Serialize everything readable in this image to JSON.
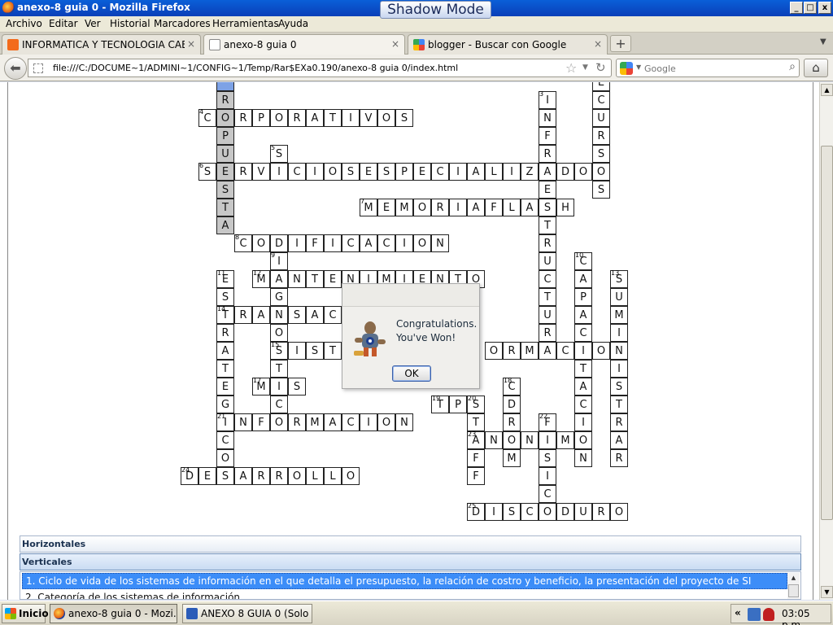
{
  "window": {
    "title": "anexo-8 guia 0 - Mozilla Firefox",
    "shadow_mode": "Shadow Mode",
    "min": "_",
    "max": "□",
    "close": "x"
  },
  "menu": [
    "Archivo",
    "Editar",
    "Ver",
    "Historial",
    "Marcadores",
    "Herramientas",
    "Ayuda"
  ],
  "tabs": [
    {
      "label": "INFORMATICA Y TECNOLOGIA CAE: 10º ...",
      "icon_color": "#f36b1c"
    },
    {
      "label": "anexo-8 guia 0",
      "icon_color": "#ffffff"
    },
    {
      "label": "blogger - Buscar con Google",
      "icon_color": "#4285f4"
    }
  ],
  "tab_close": "×",
  "new_tab": "+",
  "nav": {
    "url": "file:///C:/DOCUME~1/ADMINI~1/CONFIG~1/Temp/Rar$EXa0.190/anexo-8 guia 0/index.html",
    "search_placeholder": "Google"
  },
  "dialog": {
    "line1": "Congratulations.",
    "line2": "You've Won!",
    "ok": "OK"
  },
  "clues": {
    "horizontales": "Horizontales",
    "verticales": "Verticales",
    "items": [
      "1. Ciclo de vida de los sistemas de información en el que detalla el presupuesto, la relación de costro y beneficio, la presentación del proyecto de SI",
      "2. Categoría de los sistemas de información"
    ]
  },
  "taskbar": {
    "start": "Inicio",
    "items": [
      "anexo-8 guia 0 - Mozi...",
      "ANEXO 8 GUIA 0 (Solo le..."
    ],
    "chevron": "«",
    "clock": "03:05 p.m."
  },
  "crossword": {
    "highlight_color": "#c7c7c7",
    "selected_color": "#7da2e6",
    "words": [
      {
        "num": "",
        "text": "ROPUESTA",
        "col": 12,
        "row": 1,
        "dir": "down",
        "hl": true
      },
      {
        "num": "2",
        "text": "ECURSOS",
        "col": 33,
        "row": 0,
        "dir": "down"
      },
      {
        "num": "3",
        "text": "INFRAESTRUCTURA",
        "col": 30,
        "row": 1,
        "dir": "down"
      },
      {
        "num": "4",
        "text": "CORPORATIVOS",
        "col": 11,
        "row": 2,
        "dir": "across"
      },
      {
        "num": "5",
        "text": "S",
        "col": 15,
        "row": 4,
        "dir": "across"
      },
      {
        "num": "6",
        "text": "SERVICIOSESPECIALIZADOS",
        "col": 11,
        "row": 5,
        "dir": "across"
      },
      {
        "num": "7",
        "text": "MEMORIAFLASH",
        "col": 20,
        "row": 7,
        "dir": "across"
      },
      {
        "num": "8",
        "text": "CODIFICACION",
        "col": 13,
        "row": 9,
        "dir": "across"
      },
      {
        "num": "9",
        "text": "IAGNOSTIC",
        "col": 15,
        "row": 10,
        "dir": "down"
      },
      {
        "num": "10",
        "text": "CAPACITACION",
        "col": 32,
        "row": 10,
        "dir": "down"
      },
      {
        "num": "11",
        "text": "ESTRATEGICO",
        "col": 12,
        "row": 11,
        "dir": "down"
      },
      {
        "num": "12",
        "text": "MANTENIMIENTO",
        "col": 14,
        "row": 11,
        "dir": "across"
      },
      {
        "num": "13",
        "text": "SUMINISTRAR",
        "col": 34,
        "row": 11,
        "dir": "down"
      },
      {
        "num": "14",
        "text": "TRANSAC",
        "col": 12,
        "row": 13,
        "dir": "across"
      },
      {
        "num": "15",
        "text": "SIST",
        "col": 15,
        "row": 15,
        "dir": "across"
      },
      {
        "num": "",
        "text": "ORMACION",
        "col": 27,
        "row": 15,
        "dir": "across"
      },
      {
        "num": "17",
        "text": "MIS",
        "col": 14,
        "row": 17,
        "dir": "across"
      },
      {
        "num": "18",
        "text": "CDROM",
        "col": 28,
        "row": 17,
        "dir": "down"
      },
      {
        "num": "19",
        "text": "TPS",
        "col": 24,
        "row": 18,
        "dir": "across"
      },
      {
        "num": "20",
        "text": "STAFF",
        "col": 26,
        "row": 18,
        "dir": "down"
      },
      {
        "num": "21",
        "text": "INFORMACION",
        "col": 12,
        "row": 19,
        "dir": "across"
      },
      {
        "num": "22",
        "text": "FISIC",
        "col": 30,
        "row": 19,
        "dir": "down"
      },
      {
        "num": "23",
        "text": "ANONIMO",
        "col": 26,
        "row": 20,
        "dir": "across"
      },
      {
        "num": "24",
        "text": "DESARROLLO",
        "col": 10,
        "row": 22,
        "dir": "across"
      },
      {
        "num": "25",
        "text": "DISCODURO",
        "col": 26,
        "row": 24,
        "dir": "across"
      }
    ]
  }
}
